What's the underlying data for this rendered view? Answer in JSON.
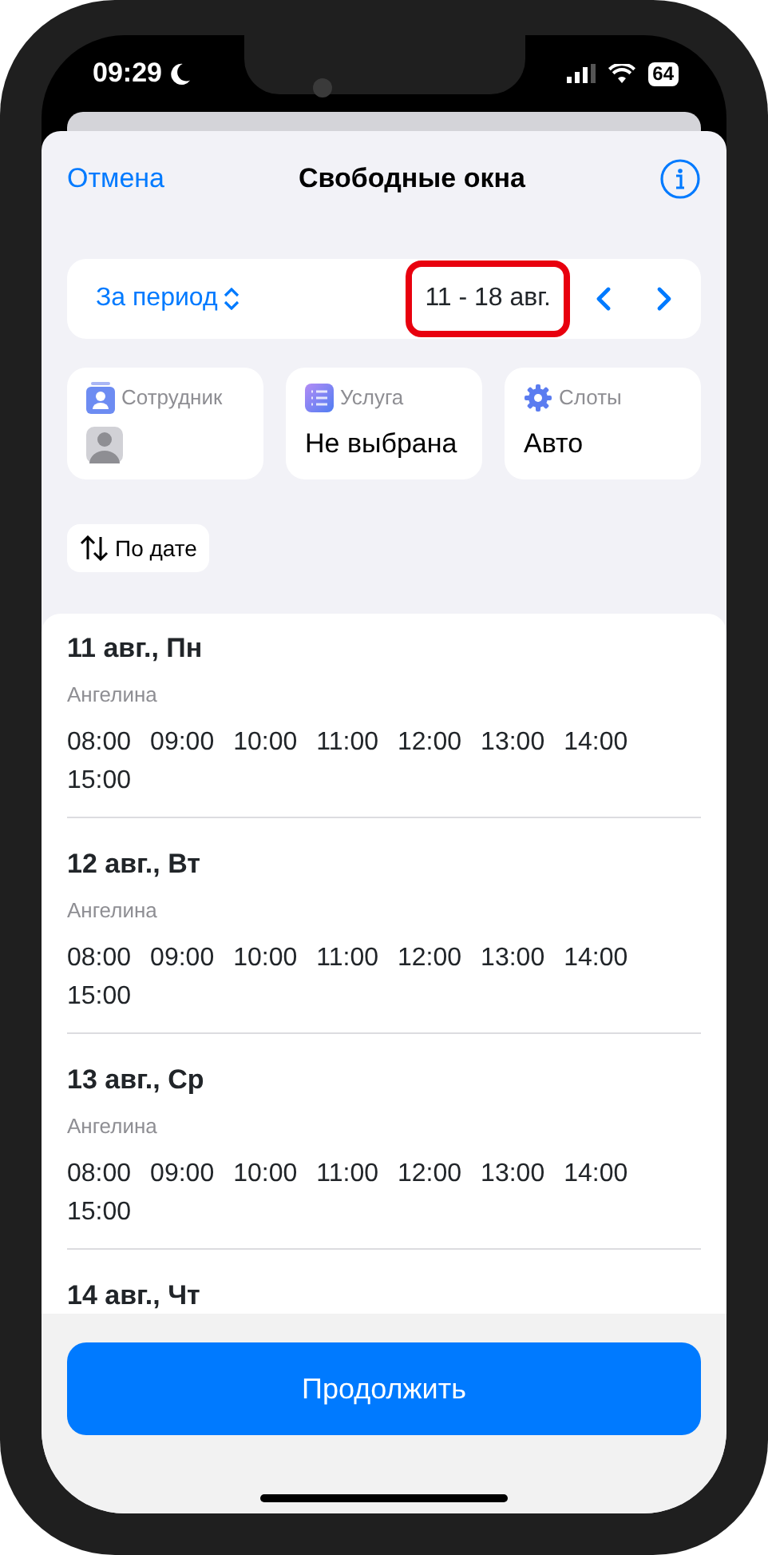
{
  "status_bar": {
    "time": "09:29",
    "do_not_disturb": true,
    "battery": "64"
  },
  "header": {
    "cancel": "Отмена",
    "title": "Свободные окна"
  },
  "period": {
    "mode": "За период",
    "range": "11 - 18 авг.",
    "highlighted": true
  },
  "filters": [
    {
      "kind": "person",
      "label": "Сотрудник"
    },
    {
      "kind": "service",
      "label": "Услуга",
      "value": "Не выбрана"
    },
    {
      "kind": "slots",
      "label": "Слоты",
      "value": "Авто"
    }
  ],
  "sort": {
    "label": "По дате"
  },
  "days": [
    {
      "title": "11 авг., Пн",
      "employee": "Ангелина",
      "times": [
        "08:00",
        "09:00",
        "10:00",
        "11:00",
        "12:00",
        "13:00",
        "14:00",
        "15:00"
      ]
    },
    {
      "title": "12 авг., Вт",
      "employee": "Ангелина",
      "times": [
        "08:00",
        "09:00",
        "10:00",
        "11:00",
        "12:00",
        "13:00",
        "14:00",
        "15:00"
      ]
    },
    {
      "title": "13 авг., Ср",
      "employee": "Ангелина",
      "times": [
        "08:00",
        "09:00",
        "10:00",
        "11:00",
        "12:00",
        "13:00",
        "14:00",
        "15:00"
      ]
    },
    {
      "title": "14 авг., Чт"
    }
  ],
  "continue_button": "Продолжить"
}
